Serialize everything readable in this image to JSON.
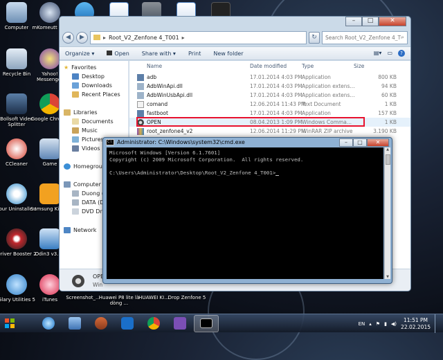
{
  "desktop": {
    "icons": [
      {
        "label": "Computer",
        "color": "#8aa9c8"
      },
      {
        "label": "mKomeutt GUI",
        "color": "#3b4c6e"
      },
      {
        "label": "Recycle Bin",
        "color": "#9bb4cd"
      },
      {
        "label": "Yahoo! Messenger",
        "color": "#7a3fb0"
      },
      {
        "label": "Bollsoft Video Splitter",
        "color": "#2a4b79"
      },
      {
        "label": "Google Chrome",
        "color": "#3f8f3a"
      },
      {
        "label": "CCleaner",
        "color": "#d23b2b"
      },
      {
        "label": "Game",
        "color": "#5f86b5"
      },
      {
        "label": "Your Uninstaller!",
        "color": "#1f82c6"
      },
      {
        "label": "Samsung Kies 3",
        "color": "#f2a120"
      },
      {
        "label": "Driver Booster 2",
        "color": "#c1272d"
      },
      {
        "label": "Odin3 v3.09",
        "color": "#3a7ec2"
      },
      {
        "label": "Glary Utilities 5",
        "color": "#2f7fc7"
      },
      {
        "label": "iTunes",
        "color": "#d8284a"
      }
    ],
    "bottom_labels": [
      "Screenshot_...",
      "Huawei P8 lite là dòng ...",
      "HUAWEI KI...",
      "Drop Zenfone 5"
    ]
  },
  "explorer": {
    "address_path": "Root_V2_Zenfone 4_T001",
    "search_placeholder": "Search Root_V2_Zenfone 4_T001",
    "toolbar": {
      "organize": "Organize ▾",
      "open": "Open",
      "share": "Share with ▾",
      "print": "Print",
      "new_folder": "New folder"
    },
    "nav": {
      "favorites": "Favorites",
      "desktop": "Desktop",
      "downloads": "Downloads",
      "recent": "Recent Places",
      "libraries": "Libraries",
      "documents": "Documents",
      "music": "Music",
      "pictures": "Pictures",
      "videos": "Videos",
      "homegroup": "Homegroup",
      "computer": "Computer",
      "duong": "Duong (C:)",
      "data": "DATA (D:)",
      "drive": "DVD Drive",
      "network": "Network"
    },
    "columns": {
      "name": "Name",
      "date": "Date modified",
      "type": "Type",
      "size": "Size"
    },
    "files": [
      {
        "name": "adb",
        "date": "17.01.2014 4:03 PM",
        "type": "Application",
        "size": "800 KB",
        "icon": "#5d7fa8"
      },
      {
        "name": "AdbWinApi.dll",
        "date": "17.01.2014 4:03 PM",
        "type": "Application extens...",
        "size": "94 KB",
        "icon": "#9db3c9"
      },
      {
        "name": "AdbWinUsbApi.dll",
        "date": "17.01.2014 4:03 PM",
        "type": "Application extens...",
        "size": "60 KB",
        "icon": "#9db3c9"
      },
      {
        "name": "comand",
        "date": "12.06.2014 11:43 PM",
        "type": "Text Document",
        "size": "1 KB",
        "icon": "#e9e9e9"
      },
      {
        "name": "fastboot",
        "date": "17.01.2014 4:03 PM",
        "type": "Application",
        "size": "157 KB",
        "icon": "#5d7fa8"
      },
      {
        "name": "OPEN",
        "date": "08.04.2013 1:09 PM",
        "type": "Windows Comma...",
        "size": "1 KB",
        "icon": "#3a3a3a"
      },
      {
        "name": "root_zenfone4_v2",
        "date": "12.06.2014 11:29 PM",
        "type": "WinRAR ZIP archive",
        "size": "3.190 KB",
        "icon": "#8a4fb0"
      }
    ],
    "details": {
      "name": "OPEN",
      "type": "Win"
    }
  },
  "cmd": {
    "title": "Administrator: C:\\Windows\\system32\\cmd.exe",
    "lines": [
      "Microsoft Windows [Version 6.1.7601]",
      "Copyright (c) 2009 Microsoft Corporation.  All rights reserved.",
      "",
      "C:\\Users\\Administrator\\Desktop\\Root_V2_Zenfone 4_T001>"
    ]
  },
  "taskbar": {
    "lang": "EN",
    "time": "11:51 PM",
    "date": "22.02.2015"
  }
}
